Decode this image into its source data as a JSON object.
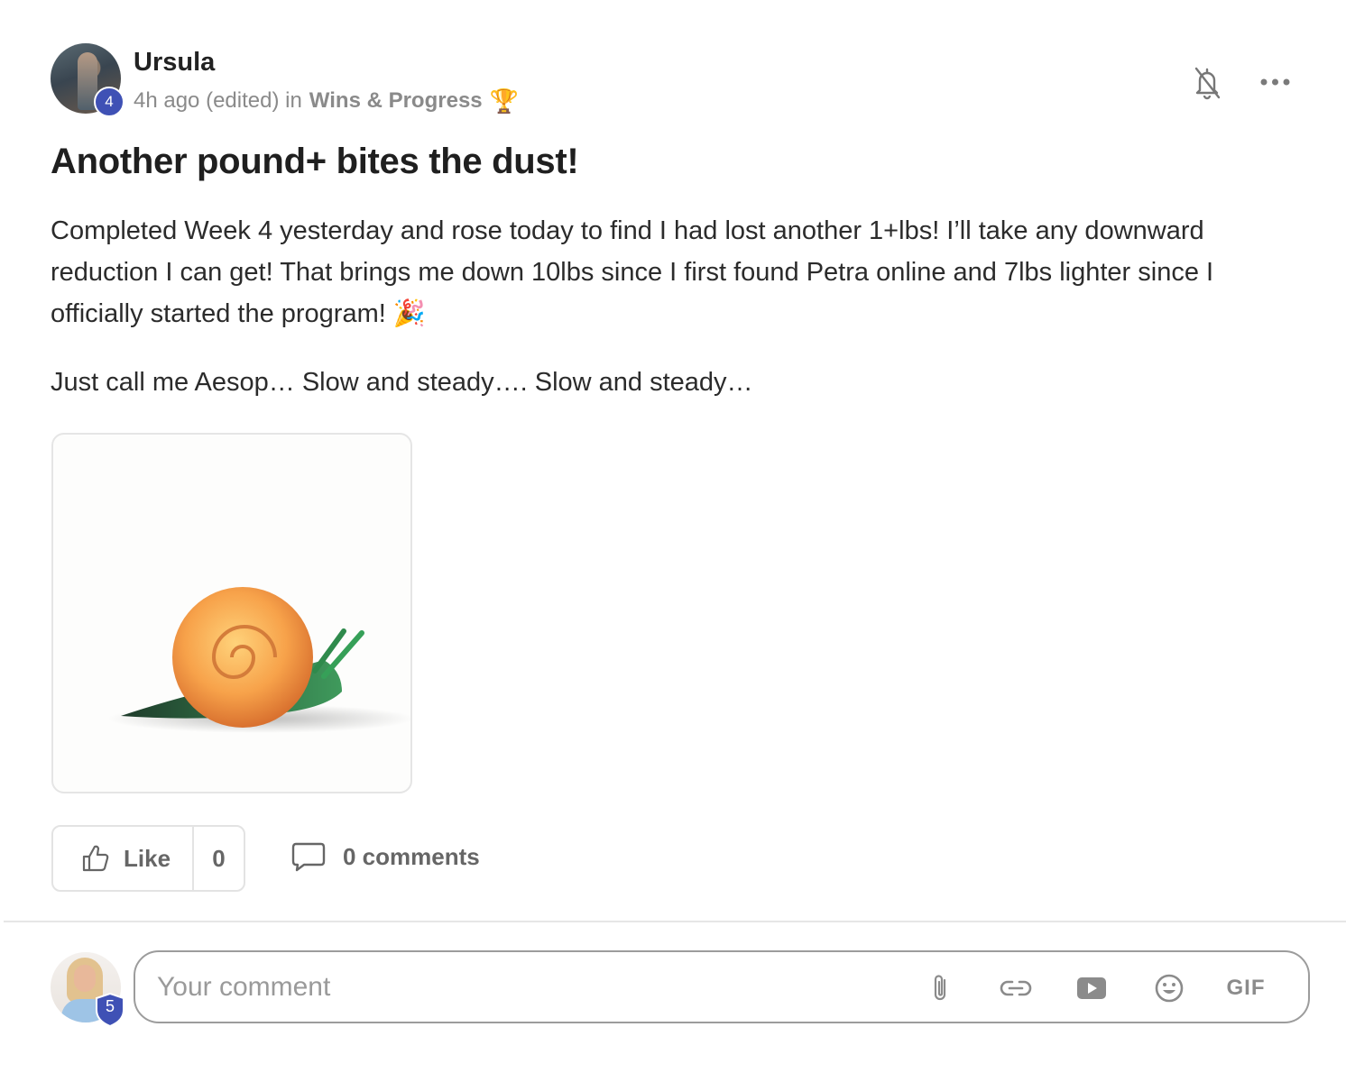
{
  "post": {
    "author": "Ursula",
    "author_level": "4",
    "time": "4h ago (edited) in",
    "category": "Wins & Progress",
    "category_emoji": "🏆",
    "title": "Another pound+ bites the dust!",
    "paragraph_1": "Completed Week 4 yesterday and rose today to find I had lost another 1+lbs! I’ll take any downward reduction I can get! That brings me down 10lbs since I first found Petra online and 7lbs lighter since I officially started the program! 🎉",
    "paragraph_2": "Just call me Aesop… Slow and steady…. Slow and steady…"
  },
  "actions": {
    "like_label": "Like",
    "like_count": "0",
    "comments_label": "0 comments"
  },
  "composer": {
    "user_level": "5",
    "placeholder": "Your comment",
    "gif_label": "GIF"
  },
  "icons": [
    "bell-off-icon",
    "more-icon",
    "thumbs-up-icon",
    "comment-icon",
    "paperclip-icon",
    "link-icon",
    "video-icon",
    "emoji-icon"
  ],
  "colors": {
    "badge_blue": "#3f51b5",
    "muted_text": "#8a8a8a",
    "border": "#e3e3e3"
  }
}
